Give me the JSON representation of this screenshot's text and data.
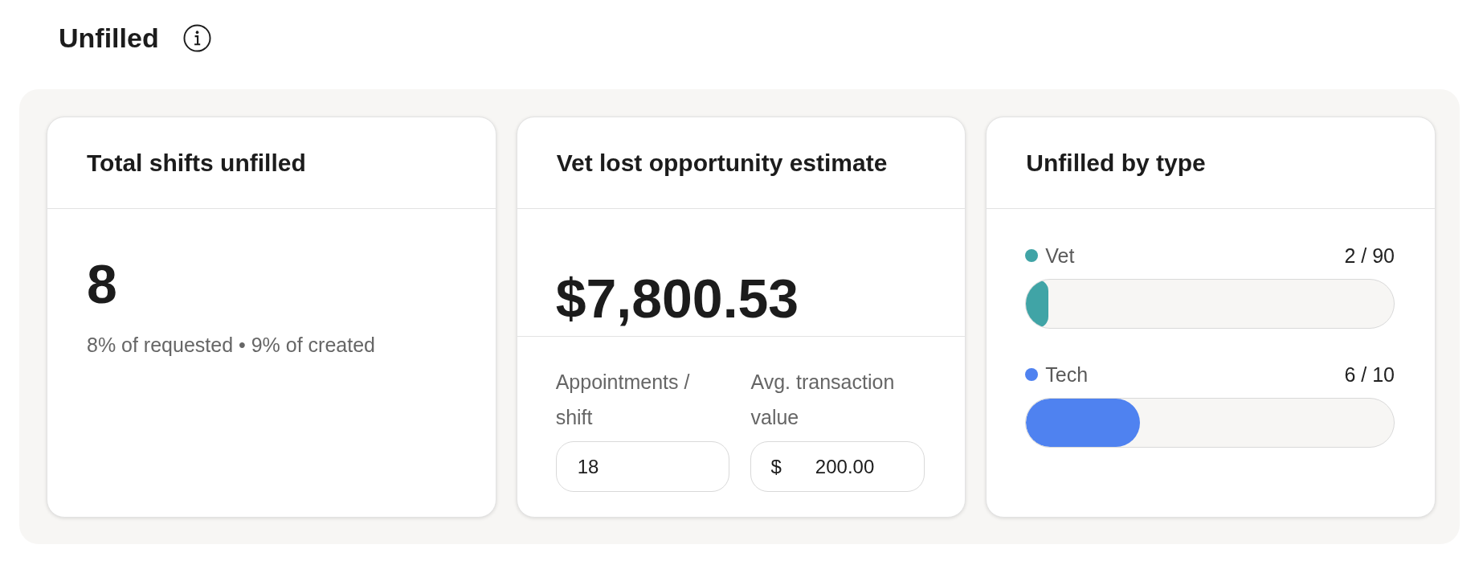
{
  "header": {
    "title": "Unfilled"
  },
  "cards": [
    {
      "kind": "total",
      "title": "Total shifts unfilled",
      "value": "8",
      "subtitle": "8% of requested • 9% of created"
    },
    {
      "kind": "estimate",
      "title": "Vet lost opportunity estimate",
      "value": "$7,800.53",
      "inputs": [
        {
          "label": "Appointments / shift",
          "value": "18"
        },
        {
          "label": "Avg. transaction value",
          "prefix": "$",
          "value": "200.00"
        }
      ]
    },
    {
      "kind": "by_type",
      "title": "Unfilled by type",
      "types": [
        {
          "name": "Vet",
          "count": "2 / 90",
          "color": "#40a4a6",
          "level": 0.06
        },
        {
          "name": "Tech",
          "count": "6 / 10",
          "color": "#4f82f0",
          "level": 0.31
        }
      ]
    }
  ]
}
